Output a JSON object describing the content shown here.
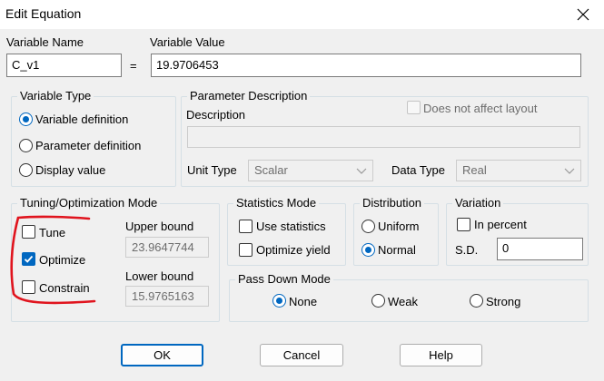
{
  "window": {
    "title": "Edit Equation"
  },
  "variable": {
    "name_label": "Variable Name",
    "value_label": "Variable Value",
    "name_value": "C_v1",
    "equals": "=",
    "value_value": "19.9706453"
  },
  "variable_type": {
    "label": "Variable Type",
    "options": [
      "Variable definition",
      "Parameter definition",
      "Display value"
    ],
    "selected": "Variable definition"
  },
  "parameter_description": {
    "label": "Parameter Description",
    "description_label": "Description",
    "does_not_affect_label": "Does not affect layout",
    "unit_type_label": "Unit Type",
    "unit_type_value": "Scalar",
    "data_type_label": "Data Type",
    "data_type_value": "Real"
  },
  "tuning": {
    "label": "Tuning/Optimization Mode",
    "tune_label": "Tune",
    "optimize_label": "Optimize",
    "constrain_label": "Constrain",
    "optimize_checked": true,
    "upper_bound_label": "Upper bound",
    "upper_bound_value": "23.9647744",
    "lower_bound_label": "Lower bound",
    "lower_bound_value": "15.9765163",
    "annotation_color": "#e0141e"
  },
  "statistics": {
    "label": "Statistics Mode",
    "use_statistics_label": "Use statistics",
    "optimize_yield_label": "Optimize yield"
  },
  "distribution": {
    "label": "Distribution",
    "uniform_label": "Uniform",
    "normal_label": "Normal",
    "selected": "Normal"
  },
  "variation": {
    "label": "Variation",
    "in_percent_label": "In percent",
    "sd_label": "S.D.",
    "sd_value": "0"
  },
  "pass_down": {
    "label": "Pass Down Mode",
    "none_label": "None",
    "weak_label": "Weak",
    "strong_label": "Strong",
    "selected": "None"
  },
  "buttons": {
    "ok": "OK",
    "cancel": "Cancel",
    "help": "Help"
  },
  "colors": {
    "accent": "#0067c0",
    "background": "#f0f0f0"
  }
}
